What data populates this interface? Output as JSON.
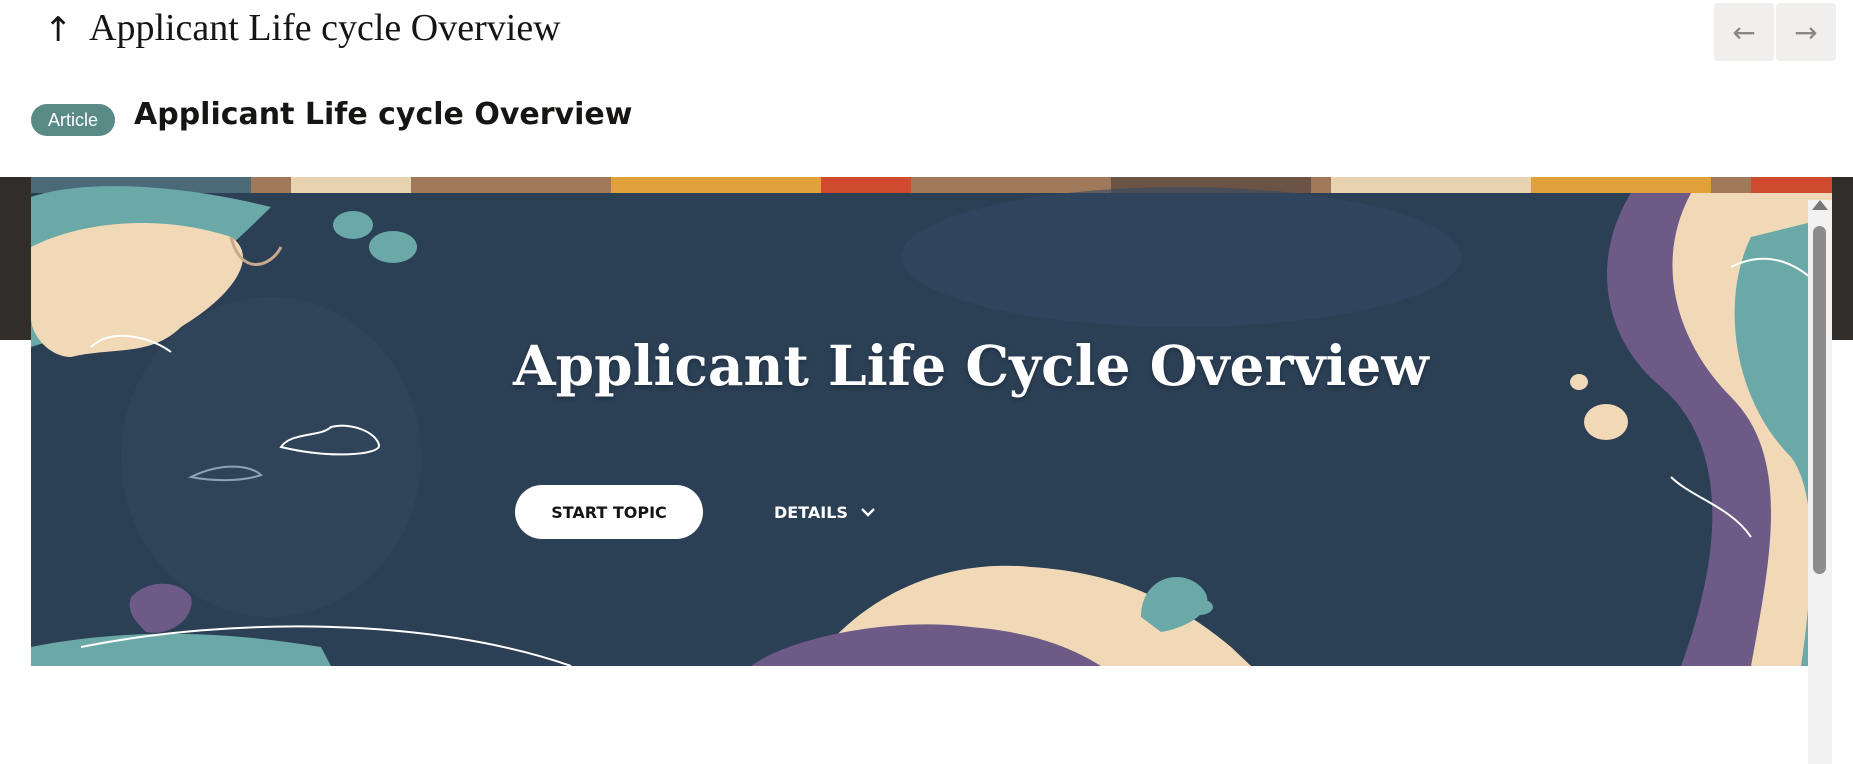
{
  "header": {
    "back_glyph": "↑",
    "title": "Applicant Life cycle Overview",
    "prev_glyph": "←",
    "next_glyph": "→"
  },
  "item": {
    "type_badge": "Article",
    "title": "Applicant Life cycle Overview"
  },
  "hero": {
    "title": "Applicant Life Cycle Overview",
    "start_button": "START TOPIC",
    "details_label": "DETAILS",
    "colors": {
      "background": "#2b3f55",
      "teal": "#6aa9a8",
      "cream": "#f1d9b8",
      "purple": "#6d5a86",
      "orange": "#e0a03a",
      "red": "#d04a2f"
    }
  },
  "colors": {
    "badge": "#5a8a86",
    "dark_band": "#312d2a"
  }
}
